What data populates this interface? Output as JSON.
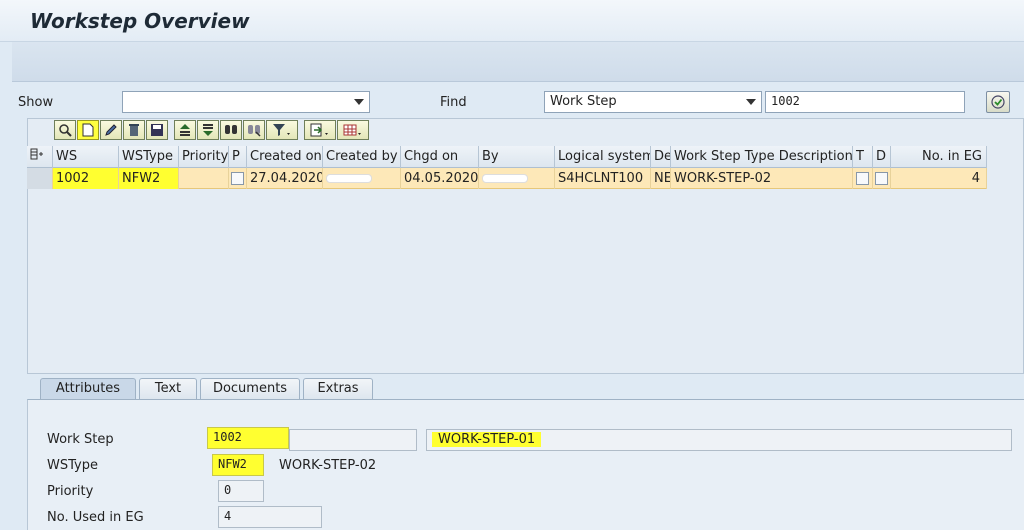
{
  "window": {
    "title": "Workstep Overview"
  },
  "search": {
    "show_label": "Show",
    "show_value": "",
    "find_label": "Find",
    "find_field": "Work Step",
    "find_value": "1002"
  },
  "table": {
    "columns": [
      "WS",
      "WSType",
      "Priority",
      "P",
      "Created on",
      "Created by",
      "Chgd on",
      "By",
      "Logical system",
      "De",
      "Work Step Type Description",
      "T",
      "D",
      "No. in EG"
    ],
    "rows": [
      {
        "ws": "1002",
        "wstype": "NFW2",
        "priority": "",
        "created_on": "27.04.2020",
        "chgd_on": "04.05.2020",
        "logical_system": "S4HCLNT100",
        "de": "NE",
        "description": "WORK-STEP-02",
        "no_in_eg": "4"
      }
    ]
  },
  "tabs": [
    "Attributes",
    "Text",
    "Documents",
    "Extras"
  ],
  "detail": {
    "work_step_label": "Work Step",
    "work_step_value": "1002",
    "work_step_desc": "WORK-STEP-01",
    "wstype_label": "WSType",
    "wstype_value": "NFW2",
    "wstype_desc": "WORK-STEP-02",
    "priority_label": "Priority",
    "priority_value": "0",
    "used_in_eg_label": "No. Used in EG",
    "used_in_eg_value": "4"
  },
  "icons": [
    "select-detail-icon",
    "create-icon",
    "edit-icon",
    "delete-icon",
    "save-icon",
    "sort-ascending-icon",
    "sort-descending-icon",
    "find-icon",
    "find-next-icon",
    "filter-icon",
    "export-icon",
    "layout-icon",
    "execute-icon",
    "column-settings-icon"
  ],
  "colors": {
    "highlight": "#ffff30",
    "selected_row": "#fde8b8",
    "panel": "#e8eff6"
  }
}
